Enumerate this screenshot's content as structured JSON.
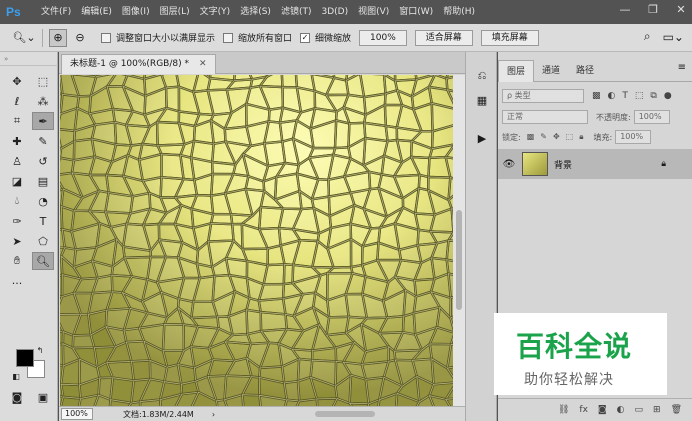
{
  "app": {
    "logo": "Ps"
  },
  "menu": [
    "文件(F)",
    "编辑(E)",
    "图像(I)",
    "图层(L)",
    "文字(Y)",
    "选择(S)",
    "滤镜(T)",
    "3D(D)",
    "视图(V)",
    "窗口(W)",
    "帮助(H)"
  ],
  "window_controls": {
    "minimize": "—",
    "maximize": "❐",
    "close": "✕"
  },
  "options_bar": {
    "zoom_tool_icon": "magnifier-icon",
    "checkboxes": [
      {
        "label": "调整窗口大小以满屏显示",
        "checked": false
      },
      {
        "label": "缩放所有窗口",
        "checked": false
      },
      {
        "label": "细微缩放",
        "checked": true
      }
    ],
    "zoom_value": "100%",
    "fit_screen": "适合屏幕",
    "fill_screen": "填充屏幕"
  },
  "document": {
    "tab_title": "未标题-1 @ 100%(RGB/8) *",
    "zoom": "100%",
    "doc_info": "文档:1.83M/2.44M"
  },
  "layers_panel": {
    "tabs": [
      "图层",
      "通道",
      "路径"
    ],
    "filter_kind": "ρ 类型",
    "blend_mode": "正常",
    "opacity_label": "不透明度:",
    "opacity_value": "100%",
    "lock_label": "锁定:",
    "fill_label": "填充:",
    "fill_value": "100%",
    "layers": [
      {
        "name": "背景",
        "visible": true,
        "locked": true
      }
    ]
  },
  "watermark": {
    "title": "百科全说",
    "subtitle": "助你轻松解决"
  },
  "colors": {
    "texture_light": "#f0ee90",
    "texture_dark": "#8a8830",
    "grout": "#5c5a22",
    "watermark_green": "#1aa34a"
  }
}
